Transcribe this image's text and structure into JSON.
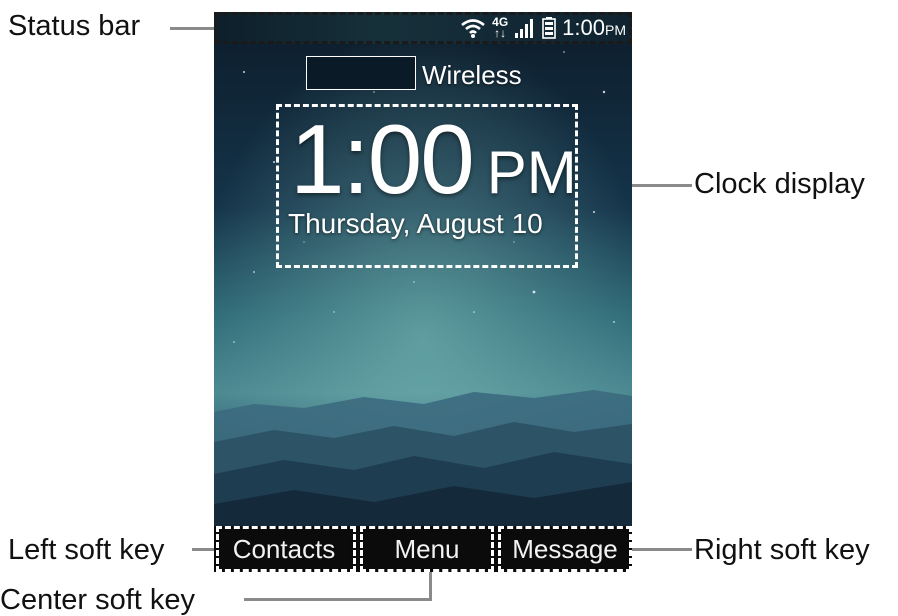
{
  "callouts": {
    "status_bar": "Status bar",
    "clock_display": "Clock display",
    "left_soft_key": "Left soft key",
    "right_soft_key": "Right soft key",
    "center_soft_key": "Center soft key"
  },
  "status_bar": {
    "icons": [
      "wifi-icon",
      "4g-lte-icon",
      "signal-strength-icon",
      "battery-icon"
    ],
    "network_label": "4G",
    "time": "1:00",
    "ampm": "PM"
  },
  "carrier": "Wireless",
  "clock": {
    "time": "1:00",
    "ampm": "PM",
    "date": "Thursday, August 10"
  },
  "soft_keys": {
    "left": "Contacts",
    "center": "Menu",
    "right": "Message"
  },
  "colors": {
    "callout_border": "#ffffff",
    "callout_border_dark": "#1a1a1a",
    "leader_line": "#8a8a8a",
    "sky_top": "#0d1e2c",
    "aurora": "#5fa8a6",
    "softkey_bar": "#0a0a0a"
  }
}
